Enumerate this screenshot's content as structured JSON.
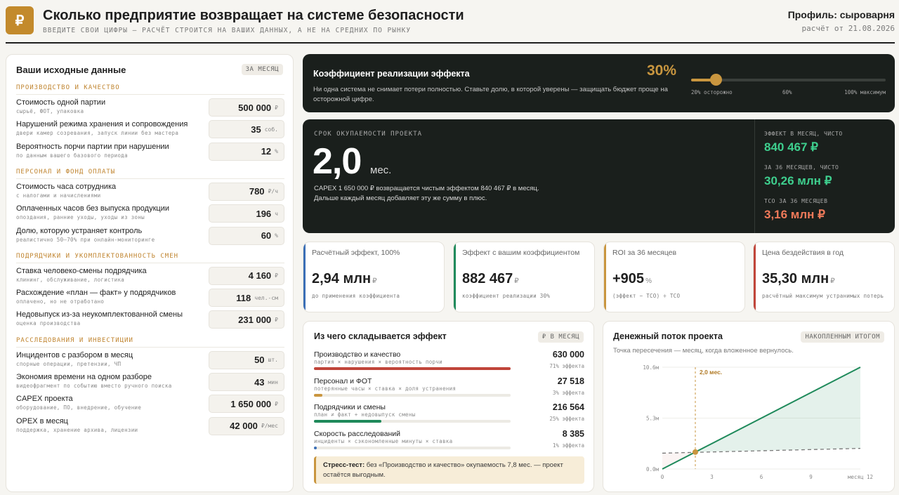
{
  "header": {
    "logo": "₽",
    "title": "Сколько предприятие возвращает на системе безопасности",
    "subtitle": "ВВЕДИТЕ СВОИ ЦИФРЫ — РАСЧЁТ СТРОИТСЯ НА ВАШИХ ДАННЫХ, А НЕ НА СРЕДНИХ ПО РЫНКУ",
    "profile": "Профиль: сыроварня",
    "date": "расчёт от 21.08.2026"
  },
  "inputs": {
    "title": "Ваши исходные данные",
    "badge": "ЗА МЕСЯЦ",
    "sections": [
      {
        "label": "ПРОИЗВОДСТВО И КАЧЕСТВО",
        "rows": [
          {
            "label": "Стоимость одной партии",
            "hint": "сырьё, ФОТ, упаковка",
            "value": "500 000",
            "unit": "₽"
          },
          {
            "label": "Нарушений режима хранения и сопровождения",
            "hint": "двери камер созревания, запуск линии без мастера",
            "value": "35",
            "unit": "соб."
          },
          {
            "label": "Вероятность порчи партии при нарушении",
            "hint": "по данным вашего базового периода",
            "value": "12",
            "unit": "%"
          }
        ]
      },
      {
        "label": "ПЕРСОНАЛ И ФОНД ОПЛАТЫ",
        "rows": [
          {
            "label": "Стоимость часа сотрудника",
            "hint": "с налогами и начислениями",
            "value": "780",
            "unit": "₽/ч"
          },
          {
            "label": "Оплаченных часов без выпуска продукции",
            "hint": "опоздания, ранние уходы, уходы из зоны",
            "value": "196",
            "unit": "ч"
          },
          {
            "label": "Долю, которую устраняет контроль",
            "hint": "реалистично 50–70% при онлайн-мониторинге",
            "value": "60",
            "unit": "%"
          }
        ]
      },
      {
        "label": "ПОДРЯДЧИКИ И УКОМПЛЕКТОВАННОСТЬ СМЕН",
        "rows": [
          {
            "label": "Ставка человеко-смены подрядчика",
            "hint": "клининг, обслуживание, логистика",
            "value": "4 160",
            "unit": "₽"
          },
          {
            "label": "Расхождение «план — факт» у подрядчиков",
            "hint": "оплачено, но не отработано",
            "value": "118",
            "unit": "чел.-см"
          },
          {
            "label": "Недовыпуск из-за неукомплектованной смены",
            "hint": "оценка производства",
            "value": "231 000",
            "unit": "₽"
          }
        ]
      },
      {
        "label": "РАССЛЕДОВАНИЯ И ИНВЕСТИЦИИ",
        "rows": [
          {
            "label": "Инцидентов с разбором в месяц",
            "hint": "спорные операции, претензии, ЧП",
            "value": "50",
            "unit": "шт."
          },
          {
            "label": "Экономия времени на одном разборе",
            "hint": "видеофрагмент по событию вместо ручного поиска",
            "value": "43",
            "unit": "мин"
          },
          {
            "label": "CAPEX проекта",
            "hint": "оборудование, ПО, внедрение, обучение",
            "value": "1 650 000",
            "unit": "₽"
          },
          {
            "label": "OPEX в месяц",
            "hint": "поддержка, хранение архива, лицензии",
            "value": "42 000",
            "unit": "₽/мес"
          }
        ]
      }
    ]
  },
  "slider": {
    "title": "Коэффициент реализации эффекта",
    "value_label": "30%",
    "value": 0.3,
    "min": 0.2,
    "max": 1.0,
    "desc": "Ни одна система не снимает потери полностью. Ставьте долю, в которой уверены — защищать бюджет проще на осторожной цифре.",
    "tick_min": "20% осторожно",
    "tick_mid": "60%",
    "tick_max": "100% максимум",
    "accent": "#c9963f"
  },
  "payback": {
    "label": "СРОК ОКУПАЕМОСТИ ПРОЕКТА",
    "value": "2,0",
    "unit": "мес.",
    "desc": "CAPEX 1 650 000 ₽ возвращается чистым эффектом 840 467 ₽ в месяц. Дальше каждый месяц добавляет эту же сумму в плюс.",
    "side": [
      {
        "label": "ЭФФЕКТ В МЕСЯЦ, ЧИСТО",
        "value": "840 467 ₽",
        "color": "#3ecf8e"
      },
      {
        "label": "ЗА 36 МЕСЯЦЕВ, ЧИСТО",
        "value": "30,26 млн ₽",
        "color": "#3ecf8e"
      },
      {
        "label": "TCO ЗА 36 МЕСЯЦЕВ",
        "value": "3,16 млн ₽",
        "color": "#f07a5a"
      }
    ]
  },
  "kpis": [
    {
      "label": "Расчётный эффект, 100%",
      "value": "2,94 млн",
      "unit": "₽",
      "hint": "до применения коэффициента",
      "color": "#3b6fb6"
    },
    {
      "label": "Эффект с вашим коэффициентом",
      "value": "882 467",
      "unit": "₽",
      "hint": "коэффициент реализации 30%",
      "color": "#1f8a5b"
    },
    {
      "label": "ROI за 36 месяцев",
      "value": "+905",
      "unit": "%",
      "hint": "(эффект − TCO) ÷ TCO",
      "color": "#c9963f"
    },
    {
      "label": "Цена бездействия в год",
      "value": "35,30 млн",
      "unit": "₽",
      "hint": "расчётный максимум устранимых потерь",
      "color": "#c0453a"
    }
  ],
  "breakdown": {
    "title": "Из чего складывается эффект",
    "badge": "₽ В МЕСЯЦ",
    "items": [
      {
        "name": "Производство и качество",
        "formula": "партия × нарушения × вероятность порчи",
        "value": "630 000",
        "share": "71% эффекта",
        "fraction": 1.0,
        "color": "#c0453a"
      },
      {
        "name": "Персонал и ФОТ",
        "formula": "потерянные часы × ставка × доля устранения",
        "value": "27 518",
        "share": "3% эффекта",
        "fraction": 0.044,
        "color": "#c9963f"
      },
      {
        "name": "Подрядчики и смены",
        "formula": "план ≠ факт + недовыпуск смены",
        "value": "216 564",
        "share": "25% эффекта",
        "fraction": 0.344,
        "color": "#1f8a5b"
      },
      {
        "name": "Скорость расследований",
        "formula": "инциденты × сэкономленные минуты × ставка",
        "value": "8 385",
        "share": "1% эффекта",
        "fraction": 0.013,
        "color": "#3b6fb6"
      }
    ],
    "stress_bold": "Стресс-тест:",
    "stress_text": "без «Производство и качество» окупаемость 7,8 мес. — проект остаётся выгодным."
  },
  "cashflow": {
    "title": "Денежный поток проекта",
    "badge": "НАКОПЛЕННЫМ ИТОГОМ",
    "subtitle": "Точка пересечения — месяц, когда вложенное вернулось.",
    "chart_data": {
      "type": "line",
      "x": [
        0,
        12
      ],
      "series": [
        {
          "values": [
            0,
            10.6
          ],
          "color": "#1f8a5b"
        },
        {
          "values": [
            1.65,
            2.15
          ],
          "color": "#777777"
        }
      ],
      "ylim": [
        0,
        10.6
      ],
      "xlim": [
        0,
        12
      ],
      "y_ticks": [
        "0.0м",
        "5.3м",
        "10.6м"
      ],
      "x_ticks": [
        "0",
        "3",
        "6",
        "9",
        "месяц 12"
      ],
      "crossover_x": 2.0,
      "crossover_label": "2,0 мес."
    }
  }
}
